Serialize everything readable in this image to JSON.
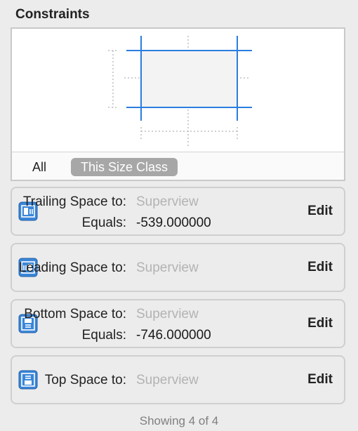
{
  "title": "Constraints",
  "scope": {
    "all": "All",
    "size_class": "This Size Class"
  },
  "constraints": [
    {
      "label": "Trailing Space to:",
      "target": "Superview",
      "equals_label": "Equals:",
      "equals": "-539.000000",
      "edit": "Edit",
      "icon": "trailing-constraint-icon"
    },
    {
      "label": "Leading Space to:",
      "target": "Superview",
      "edit": "Edit",
      "icon": "leading-constraint-icon"
    },
    {
      "label": "Bottom Space to:",
      "target": "Superview",
      "equals_label": "Equals:",
      "equals": "-746.000000",
      "edit": "Edit",
      "icon": "bottom-constraint-icon"
    },
    {
      "label": "Top Space to:",
      "target": "Superview",
      "edit": "Edit",
      "icon": "top-constraint-icon"
    }
  ],
  "footer": "Showing 4 of 4",
  "colors": {
    "accent": "#2a7de1",
    "icon_fill": "#3a86d8"
  }
}
